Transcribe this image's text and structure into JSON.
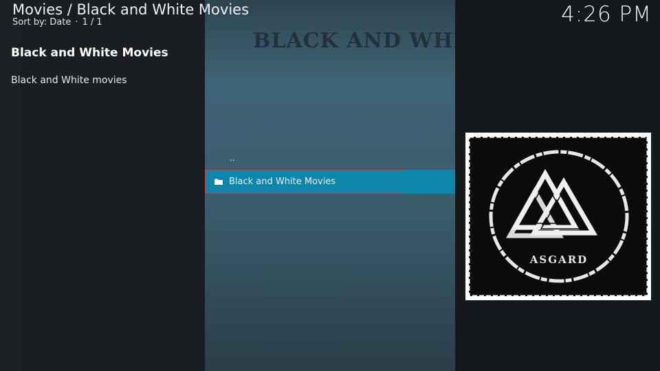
{
  "header": {
    "breadcrumb": "Movies / Black and White Movies",
    "sort_label": "Sort by: Date",
    "page_indicator": "1 / 1",
    "clock": "4:26 PM"
  },
  "fanart": {
    "title_text": "BLACK AND WHITE MOVIES"
  },
  "info": {
    "title": "Black and White Movies",
    "description": "Black and White movies"
  },
  "list": {
    "parent_label": "..",
    "items": [
      {
        "label": "Black and White Movies",
        "icon": "folder-icon",
        "selected": true
      }
    ]
  },
  "thumbnail": {
    "logo_text": "ASGARD",
    "icon": "valknut-logo"
  },
  "colors": {
    "accent": "#0e86ab",
    "focus_border": "#d6363a",
    "center_panel": "#3f6475"
  }
}
